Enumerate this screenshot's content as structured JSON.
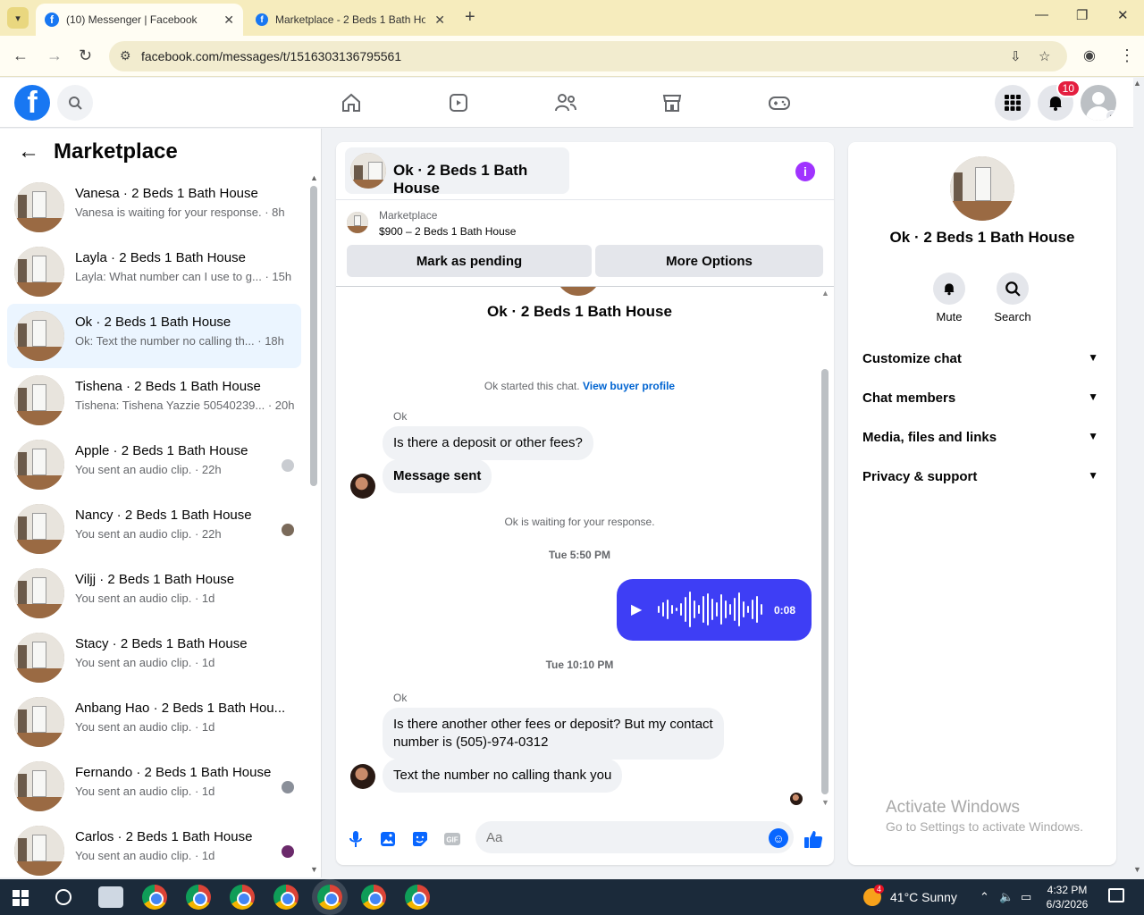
{
  "browser": {
    "tabs": [
      {
        "title": "(10) Messenger | Facebook",
        "active": true
      },
      {
        "title": "Marketplace - 2 Beds 1 Bath Ho",
        "active": false
      }
    ],
    "url": "facebook.com/messages/t/1516303136795561"
  },
  "fbnav": {
    "logo": "f",
    "notifications_count": "10"
  },
  "sidebar": {
    "title": "Marketplace",
    "conversations": [
      {
        "name": "Vanesa · 2 Beds 1 Bath House",
        "preview": "Vanesa is waiting for your response. · 8h"
      },
      {
        "name": "Layla · 2 Beds 1 Bath House",
        "preview": "Layla: What number can I use to g... · 15h"
      },
      {
        "name": "Ok · 2 Beds 1 Bath House",
        "preview": "Ok: Text the number no calling th... · 18h"
      },
      {
        "name": "Tishena · 2 Beds 1 Bath House",
        "preview": "Tishena: Tishena Yazzie 50540239... · 20h"
      },
      {
        "name": "Apple · 2 Beds 1 Bath House",
        "preview": "You sent an audio clip. · 22h"
      },
      {
        "name": "Nancy · 2 Beds 1 Bath House",
        "preview": "You sent an audio clip. · 22h"
      },
      {
        "name": "Viljj · 2 Beds 1 Bath House",
        "preview": "You sent an audio clip. · 1d"
      },
      {
        "name": "Stacy · 2 Beds 1 Bath House",
        "preview": "You sent an audio clip. · 1d"
      },
      {
        "name": "Anbang Hao · 2 Beds 1 Bath Hou...",
        "preview": "You sent an audio clip. · 1d"
      },
      {
        "name": "Fernando · 2 Beds 1 Bath House",
        "preview": "You sent an audio clip. · 1d"
      },
      {
        "name": "Carlos · 2 Beds 1 Bath House",
        "preview": "You sent an audio clip. · 1d"
      }
    ]
  },
  "chat": {
    "header_title": "Ok · 2 Beds 1 Bath House",
    "marketplace_label": "Marketplace",
    "listing": "$900 – 2 Beds 1 Bath House",
    "mark_pending": "Mark as pending",
    "more_options": "More Options",
    "conversation_title": "Ok · 2 Beds 1 Bath House",
    "started_text": "Ok started this chat.",
    "view_profile": "View buyer profile",
    "sender1": "Ok",
    "msg1": "Is there a deposit or other fees?",
    "msg2": "Message sent",
    "waiting": "Ok is waiting for your response.",
    "time1": "Tue 5:50 PM",
    "audio_duration": "0:08",
    "time2": "Tue 10:10 PM",
    "sender2": "Ok",
    "msg3_line1": "Is there another other fees or deposit? But my contact",
    "msg3_line2": "number is (505)-974-0312",
    "msg4": "Text the number no calling thank you",
    "composer_placeholder": "Aa",
    "composer_icons": [
      "microphone-icon",
      "photo-icon",
      "sticker-icon",
      "gif-icon"
    ]
  },
  "rpanel": {
    "title": "Ok · 2 Beds 1 Bath House",
    "mute": "Mute",
    "search": "Search",
    "sections": [
      "Customize chat",
      "Chat members",
      "Media, files and links",
      "Privacy & support"
    ],
    "watermark_title": "Activate Windows",
    "watermark_sub": "Go to Settings to activate Windows."
  },
  "taskbar": {
    "weather_badge": "4",
    "weather": "41°C  Sunny",
    "time": "4:32 PM",
    "date": "6/3/2026"
  },
  "colors": {
    "fb_blue": "#1877f2",
    "messenger_blue": "#0866ff",
    "audio_bubble": "#3e3ef5",
    "info_purple": "#a033ff"
  }
}
